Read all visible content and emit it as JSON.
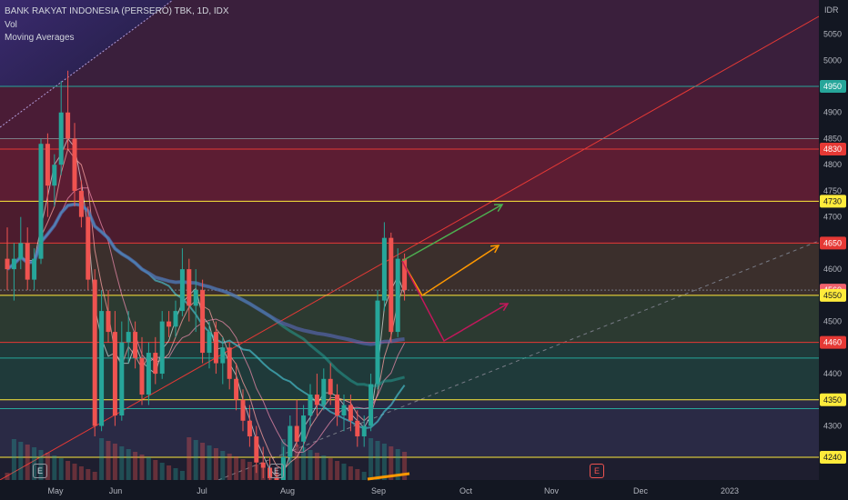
{
  "header": {
    "symbol_line": "BANK RAKYAT INDONESIA (PERSERO) TBK, 1D, IDX",
    "indicator_vol": "Vol",
    "indicator_ma": "Moving Averages"
  },
  "price_axis": {
    "currency": "IDR",
    "ticks": [
      "5050",
      "5000",
      "4900",
      "4850",
      "4800",
      "4750",
      "4700",
      "4600",
      "4500",
      "4400",
      "4300"
    ]
  },
  "price_tags": [
    {
      "label": "4950",
      "bg": "#26a69a",
      "fg": "#ffffff"
    },
    {
      "label": "4830",
      "bg": "#e53935",
      "fg": "#ffffff"
    },
    {
      "label": "4730",
      "bg": "#ffeb3b",
      "fg": "#131722"
    },
    {
      "label": "4650",
      "bg": "#e53935",
      "fg": "#ffffff"
    },
    {
      "label": "4560",
      "bg": "#f0616d",
      "fg": "#ffffff"
    },
    {
      "label": "4550",
      "bg": "#ffeb3b",
      "fg": "#131722"
    },
    {
      "label": "4460",
      "bg": "#e53935",
      "fg": "#ffffff"
    },
    {
      "label": "4350",
      "bg": "#ffeb3b",
      "fg": "#131722"
    },
    {
      "label": "4240",
      "bg": "#ffeb3b",
      "fg": "#131722"
    }
  ],
  "time_axis": [
    "May",
    "Jun",
    "Jul",
    "Aug",
    "Sep",
    "Oct",
    "Nov",
    "Dec",
    "2023"
  ],
  "events": [
    {
      "label": "E",
      "kind": "earnings-past"
    },
    {
      "label": "E",
      "kind": "earnings-past"
    },
    {
      "label": "E",
      "kind": "earnings-upcoming"
    }
  ],
  "colors": {
    "background": "#131722",
    "up_candle": "#26a69a",
    "down_candle": "#ef5350",
    "resistance": "#e53935",
    "level": "#ffeb3b",
    "support": "#26a69a",
    "arrow_green": "#4caf50",
    "arrow_orange": "#ff9800",
    "arrow_red": "#c2185b"
  },
  "chart_data": {
    "type": "candlestick",
    "title": "BANK RAKYAT INDONESIA (PERSERO) TBK, 1D, IDX",
    "ylabel": "IDR",
    "ylim": [
      4210,
      5090
    ],
    "x_months": [
      "May",
      "Jun",
      "Jul",
      "Aug",
      "Sep",
      "Oct",
      "Nov",
      "Dec",
      "2023"
    ],
    "horizontal_levels": [
      4950,
      4830,
      4730,
      4650,
      4560,
      4550,
      4460,
      4350,
      4240
    ],
    "last_price": 4560,
    "candles": [
      {
        "o": 4620,
        "h": 4680,
        "l": 4560,
        "c": 4600
      },
      {
        "o": 4600,
        "h": 4650,
        "l": 4540,
        "c": 4620
      },
      {
        "o": 4620,
        "h": 4700,
        "l": 4600,
        "c": 4650
      },
      {
        "o": 4650,
        "h": 4680,
        "l": 4560,
        "c": 4580
      },
      {
        "o": 4580,
        "h": 4640,
        "l": 4560,
        "c": 4620
      },
      {
        "o": 4620,
        "h": 4850,
        "l": 4610,
        "c": 4840
      },
      {
        "o": 4840,
        "h": 4860,
        "l": 4700,
        "c": 4760
      },
      {
        "o": 4760,
        "h": 4820,
        "l": 4720,
        "c": 4800
      },
      {
        "o": 4800,
        "h": 4960,
        "l": 4780,
        "c": 4900
      },
      {
        "o": 4900,
        "h": 4980,
        "l": 4830,
        "c": 4850
      },
      {
        "o": 4850,
        "h": 4880,
        "l": 4720,
        "c": 4750
      },
      {
        "o": 4750,
        "h": 4770,
        "l": 4680,
        "c": 4700
      },
      {
        "o": 4700,
        "h": 4720,
        "l": 4560,
        "c": 4580
      },
      {
        "o": 4580,
        "h": 4600,
        "l": 4280,
        "c": 4300
      },
      {
        "o": 4300,
        "h": 4560,
        "l": 4290,
        "c": 4520
      },
      {
        "o": 4520,
        "h": 4560,
        "l": 4460,
        "c": 4480
      },
      {
        "o": 4480,
        "h": 4520,
        "l": 4300,
        "c": 4320
      },
      {
        "o": 4320,
        "h": 4500,
        "l": 4310,
        "c": 4460
      },
      {
        "o": 4460,
        "h": 4520,
        "l": 4420,
        "c": 4480
      },
      {
        "o": 4480,
        "h": 4500,
        "l": 4410,
        "c": 4430
      },
      {
        "o": 4430,
        "h": 4470,
        "l": 4340,
        "c": 4360
      },
      {
        "o": 4360,
        "h": 4460,
        "l": 4340,
        "c": 4440
      },
      {
        "o": 4440,
        "h": 4470,
        "l": 4380,
        "c": 4400
      },
      {
        "o": 4400,
        "h": 4520,
        "l": 4390,
        "c": 4500
      },
      {
        "o": 4500,
        "h": 4520,
        "l": 4470,
        "c": 4490
      },
      {
        "o": 4490,
        "h": 4540,
        "l": 4470,
        "c": 4520
      },
      {
        "o": 4520,
        "h": 4640,
        "l": 4510,
        "c": 4600
      },
      {
        "o": 4600,
        "h": 4620,
        "l": 4500,
        "c": 4530
      },
      {
        "o": 4530,
        "h": 4600,
        "l": 4480,
        "c": 4560
      },
      {
        "o": 4560,
        "h": 4580,
        "l": 4420,
        "c": 4440
      },
      {
        "o": 4440,
        "h": 4500,
        "l": 4410,
        "c": 4480
      },
      {
        "o": 4480,
        "h": 4500,
        "l": 4400,
        "c": 4420
      },
      {
        "o": 4420,
        "h": 4470,
        "l": 4380,
        "c": 4450
      },
      {
        "o": 4450,
        "h": 4460,
        "l": 4370,
        "c": 4390
      },
      {
        "o": 4390,
        "h": 4420,
        "l": 4330,
        "c": 4350
      },
      {
        "o": 4350,
        "h": 4370,
        "l": 4290,
        "c": 4310
      },
      {
        "o": 4310,
        "h": 4340,
        "l": 4260,
        "c": 4280
      },
      {
        "o": 4280,
        "h": 4300,
        "l": 4210,
        "c": 4230
      },
      {
        "o": 4230,
        "h": 4260,
        "l": 4200,
        "c": 4220
      },
      {
        "o": 4220,
        "h": 4240,
        "l": 4190,
        "c": 4200
      },
      {
        "o": 4200,
        "h": 4220,
        "l": 4180,
        "c": 4190
      },
      {
        "o": 4190,
        "h": 4260,
        "l": 4180,
        "c": 4240
      },
      {
        "o": 4240,
        "h": 4320,
        "l": 4230,
        "c": 4300
      },
      {
        "o": 4300,
        "h": 4350,
        "l": 4260,
        "c": 4270
      },
      {
        "o": 4270,
        "h": 4340,
        "l": 4250,
        "c": 4320
      },
      {
        "o": 4320,
        "h": 4380,
        "l": 4300,
        "c": 4360
      },
      {
        "o": 4360,
        "h": 4400,
        "l": 4320,
        "c": 4340
      },
      {
        "o": 4340,
        "h": 4410,
        "l": 4330,
        "c": 4390
      },
      {
        "o": 4390,
        "h": 4420,
        "l": 4340,
        "c": 4360
      },
      {
        "o": 4360,
        "h": 4380,
        "l": 4300,
        "c": 4320
      },
      {
        "o": 4320,
        "h": 4360,
        "l": 4290,
        "c": 4340
      },
      {
        "o": 4340,
        "h": 4360,
        "l": 4290,
        "c": 4310
      },
      {
        "o": 4310,
        "h": 4330,
        "l": 4260,
        "c": 4280
      },
      {
        "o": 4280,
        "h": 4320,
        "l": 4260,
        "c": 4300
      },
      {
        "o": 4300,
        "h": 4400,
        "l": 4290,
        "c": 4380
      },
      {
        "o": 4380,
        "h": 4560,
        "l": 4370,
        "c": 4540
      },
      {
        "o": 4540,
        "h": 4690,
        "l": 4520,
        "c": 4660
      },
      {
        "o": 4660,
        "h": 4670,
        "l": 4460,
        "c": 4480
      },
      {
        "o": 4480,
        "h": 4640,
        "l": 4470,
        "c": 4620
      },
      {
        "o": 4620,
        "h": 4630,
        "l": 4540,
        "c": 4560
      }
    ]
  }
}
